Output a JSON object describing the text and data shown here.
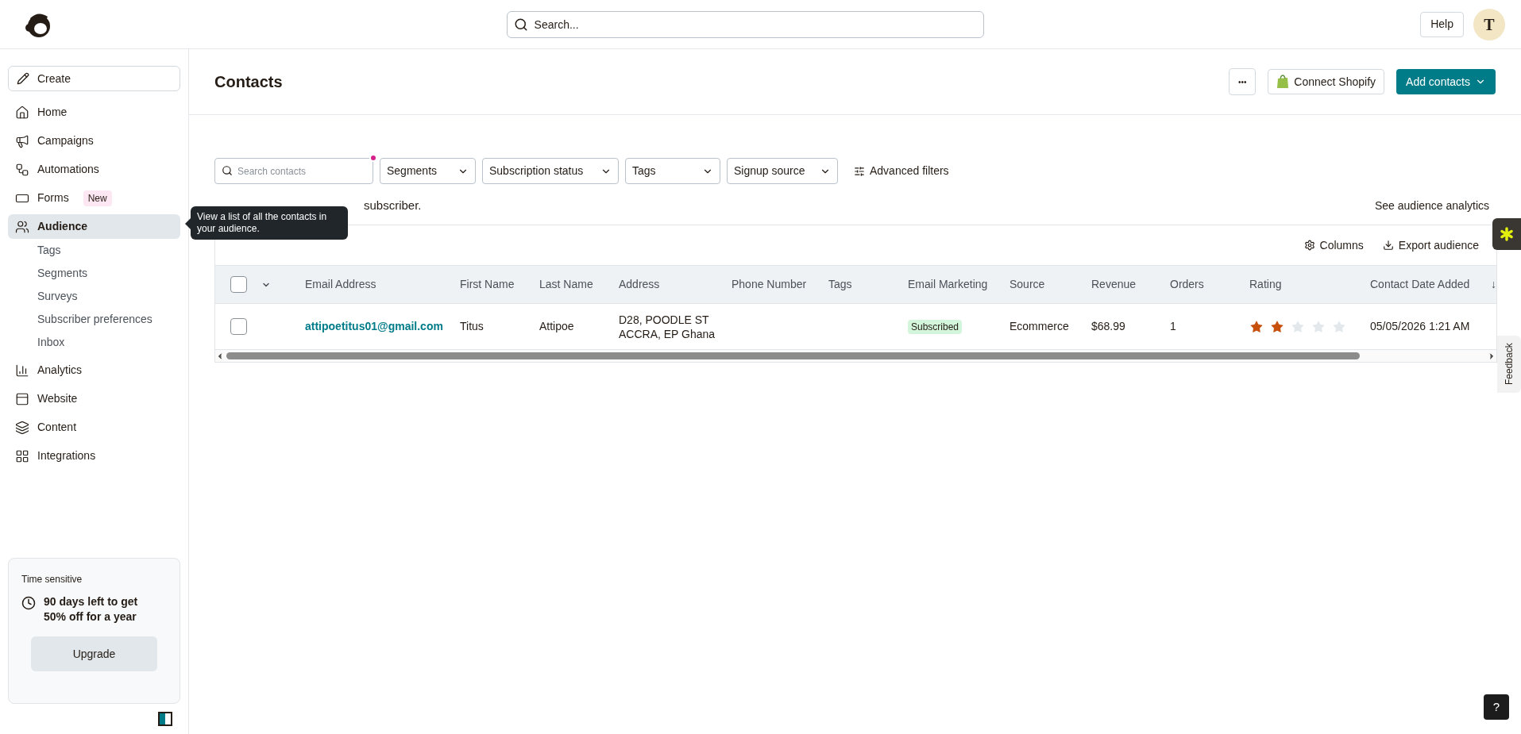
{
  "top_bar": {
    "search": {
      "placeholder": "Search..."
    },
    "help": "Help",
    "avatar": "T"
  },
  "sidebar": {
    "create": "Create",
    "items": [
      {
        "label": "Home",
        "selected": false
      },
      {
        "label": "Campaigns",
        "selected": false
      },
      {
        "label": "Automations",
        "selected": false
      },
      {
        "label": "Forms",
        "badge": "New",
        "selected": false
      },
      {
        "label": "Audience",
        "selected": true,
        "children": [
          {
            "label": "Tags"
          },
          {
            "label": "Segments"
          },
          {
            "label": "Surveys"
          },
          {
            "label": "Subscriber preferences"
          },
          {
            "label": "Inbox"
          }
        ]
      },
      {
        "label": "Analytics",
        "selected": false
      },
      {
        "label": "Website",
        "selected": false
      },
      {
        "label": "Content",
        "selected": false
      },
      {
        "label": "Integrations",
        "selected": false
      }
    ],
    "promo": {
      "heading": "Time sensitive",
      "text": "90 days left to get 50% off for a year",
      "button": "Upgrade"
    }
  },
  "tooltip": "View a list of all the contacts in your audience.",
  "page": {
    "title": "Contacts",
    "more": "•••",
    "connect_shopify": "Connect Shopify",
    "add_contacts": "Add contacts"
  },
  "filters": {
    "search": {
      "placeholder": "Search contacts"
    },
    "dropdowns": [
      "Segments",
      "Subscription status",
      "Tags",
      "Signup source"
    ],
    "advanced": "Advanced filters"
  },
  "summary": "subscriber.",
  "analytics_link": "See audience analytics",
  "table": {
    "actions": [
      "Columns",
      "Export audience"
    ],
    "select_all": {
      "checked": false
    },
    "columns": [
      "Email Address",
      "First Name",
      "Last Name",
      "Address",
      "Phone Number",
      "Tags",
      "Email Marketing",
      "Source",
      "Revenue",
      "Orders",
      "Rating",
      "Contact Date Added"
    ],
    "sort_arrow": "↓",
    "rows": [
      {
        "checked": false,
        "email": "attipoetitus01@gmail.com",
        "first_name": "Titus",
        "last_name": "Attipoe",
        "address": [
          "D28, POODLE ST",
          "ACCRA, EP Ghana"
        ],
        "email_marketing": "Subscribed",
        "source": "Ecommerce",
        "revenue": "$68.99",
        "orders": "1",
        "stars": 2,
        "date_added": "05/05/2026 1:21 AM"
      }
    ]
  },
  "feedback": "Feedback",
  "help_button": "?"
}
